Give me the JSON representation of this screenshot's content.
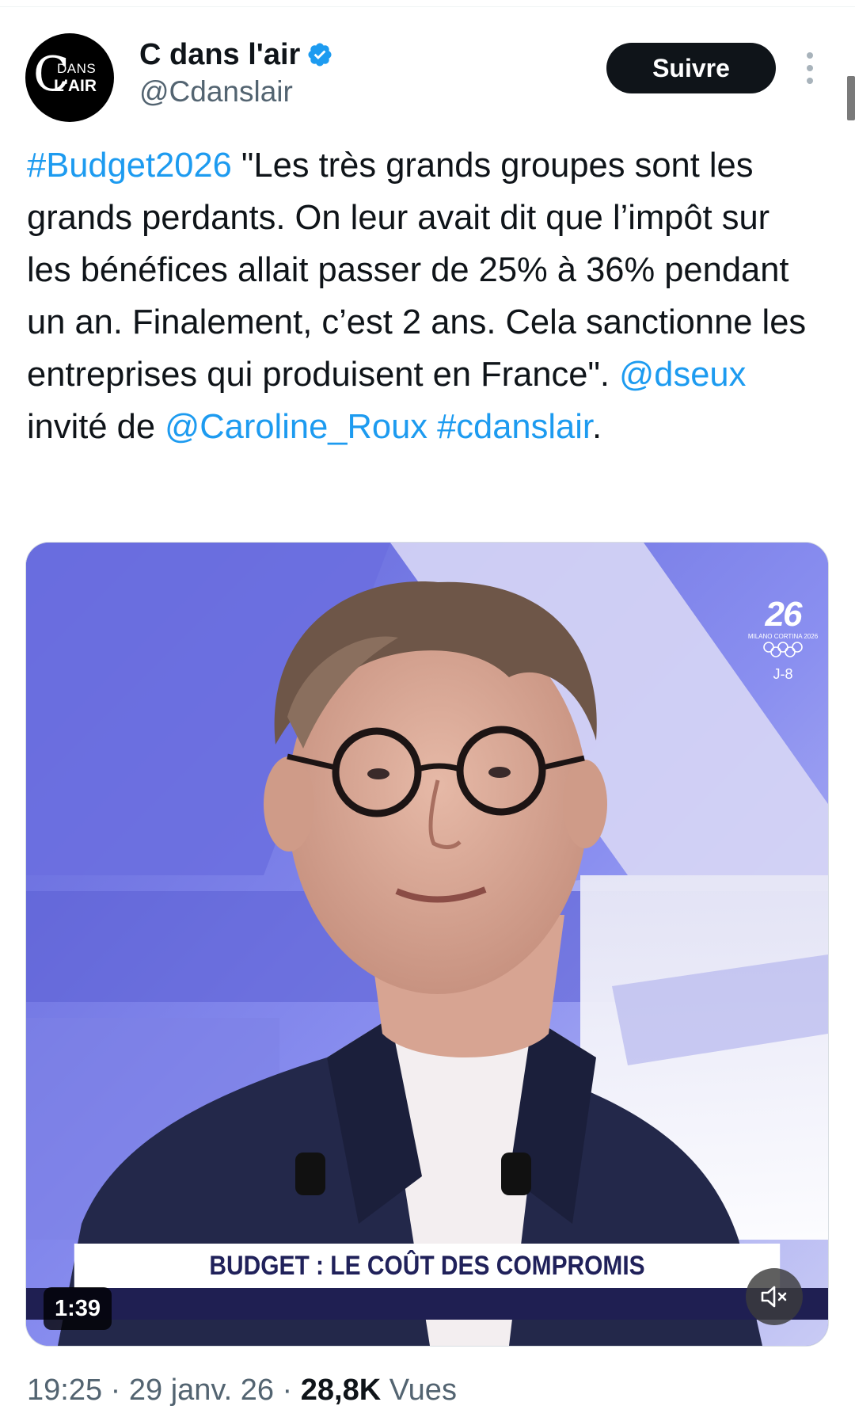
{
  "author": {
    "display_name": "C dans l'air",
    "handle": "@Cdanslair",
    "avatar_text": {
      "letter": "C",
      "top": "DANS",
      "bottom": "L'AIR"
    },
    "verified": true
  },
  "follow_button": {
    "label": "Suivre"
  },
  "tweet": {
    "parts": [
      {
        "text": "#Budget2026",
        "type": "hashtag"
      },
      {
        "text": " \"Les très grands groupes sont les grands perdants. On leur avait dit que l’impôt sur les bénéfices allait passer de 25% à 36% pendant un an. Finalement, c’est 2 ans. Cela sanctionne les entreprises qui produisent en France\". ",
        "type": "text"
      },
      {
        "text": "@dseux",
        "type": "mention"
      },
      {
        "text": " invité de ",
        "type": "text"
      },
      {
        "text": "@Caroline_Roux",
        "type": "mention"
      },
      {
        "text": " ",
        "type": "text"
      },
      {
        "text": "#cdanslair",
        "type": "hashtag"
      },
      {
        "text": ".",
        "type": "text"
      }
    ]
  },
  "media": {
    "banner": "BUDGET : LE COÛT DES COMPROMIS",
    "duration": "1:39",
    "badge": {
      "logo": "26",
      "subtitle": "MILANO CORTINA 2026",
      "countdown": "J-8"
    },
    "icons": {
      "mute": "speaker-muted-icon"
    }
  },
  "meta": {
    "time": "19:25",
    "separator": " · ",
    "date": "29 janv. 26",
    "views_count": "28,8K",
    "views_label": "Vues"
  },
  "colors": {
    "link": "#1d9bf0",
    "text": "#0f1419",
    "secondary": "#536471",
    "verified": "#1d9bf0",
    "follow_bg": "#0f1419",
    "banner_text": "#20215a"
  }
}
